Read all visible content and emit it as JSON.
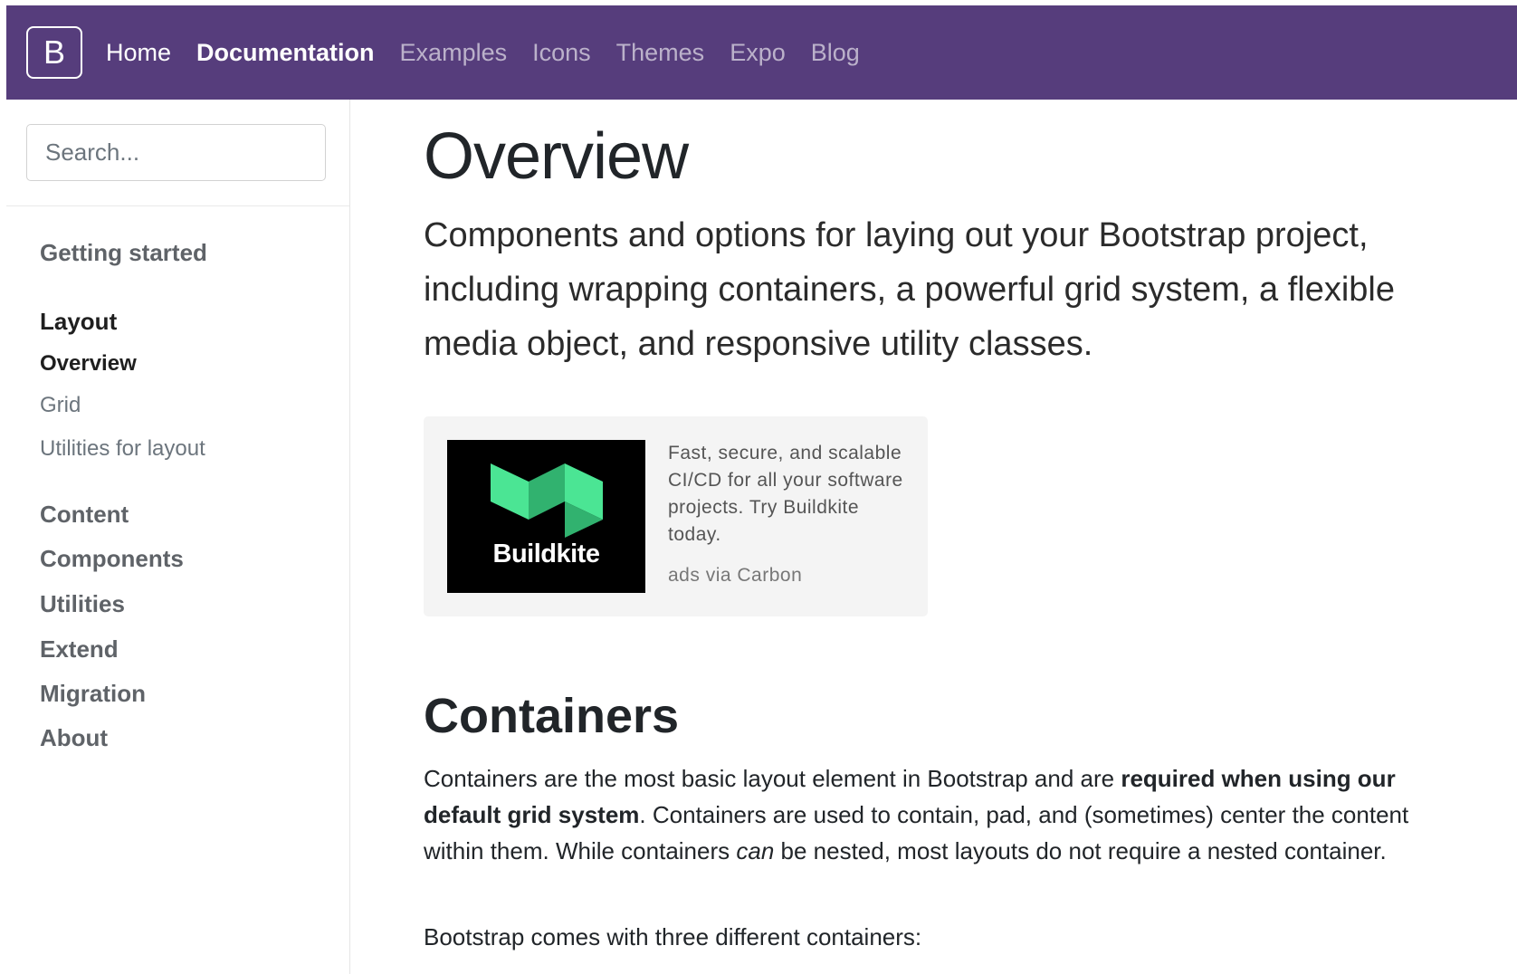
{
  "colors": {
    "brand": "#563d7c",
    "ad_green_light": "#4be594",
    "ad_green_dark": "#31b26f"
  },
  "navbar": {
    "brand_letter": "B",
    "links": [
      "Home",
      "Documentation",
      "Examples",
      "Icons",
      "Themes",
      "Expo",
      "Blog"
    ]
  },
  "sidebar": {
    "search_placeholder": "Search...",
    "getting_started": "Getting started",
    "layout": "Layout",
    "layout_items": [
      "Overview",
      "Grid",
      "Utilities for layout"
    ],
    "sections": [
      "Content",
      "Components",
      "Utilities",
      "Extend",
      "Migration",
      "About"
    ]
  },
  "main": {
    "title": "Overview",
    "lead": "Components and options for laying out your Bootstrap project, including wrapping containers, a powerful grid system, a flexible media object, and responsive utility classes.",
    "ad": {
      "brand": "Buildkite",
      "text": "Fast, secure, and scalable CI/CD for all your software projects. Try Buildkite today.",
      "via": "ads via Carbon"
    },
    "containers_heading": "Containers",
    "containers_p1_a": "Containers are the most basic layout element in Bootstrap and are ",
    "containers_p1_b": "required when using our default grid system",
    "containers_p1_c": ". Containers are used to contain, pad, and (sometimes) center the content within them. While containers ",
    "containers_p1_d": "can",
    "containers_p1_e": " be nested, most layouts do not require a nested container.",
    "containers_p2": "Bootstrap comes with three different containers:"
  }
}
